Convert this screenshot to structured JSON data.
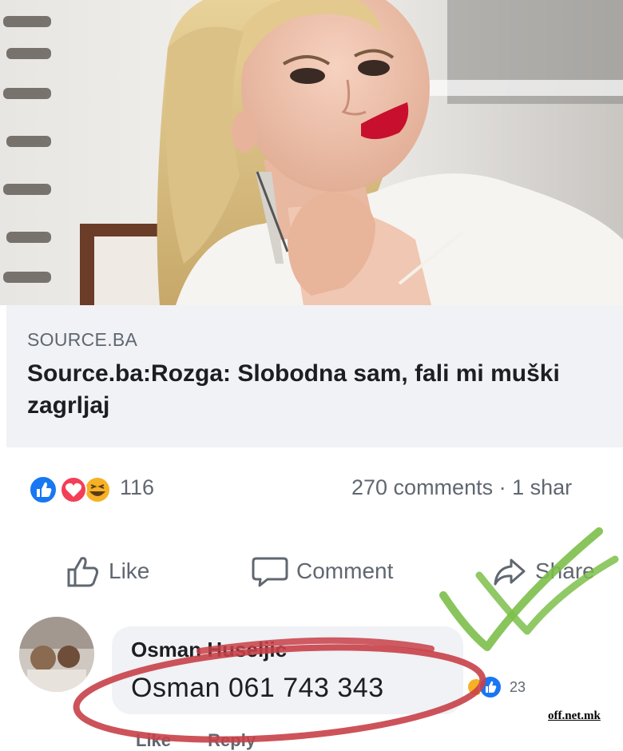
{
  "post": {
    "link": {
      "source": "SOURCE.BA",
      "title": "Source.ba:Rozga: Slobodna sam, fali mi muški zagrljaj"
    },
    "reactions": {
      "types": [
        "like-icon",
        "love-icon",
        "haha-icon"
      ],
      "count": "116"
    },
    "comments_shares": "270 comments · 1 shar",
    "actions": {
      "like": "Like",
      "comment": "Comment",
      "share": "Share"
    }
  },
  "comment": {
    "author": "Osman Huseljic",
    "text": "Osman 061 743 343",
    "reaction_count": "23",
    "actions": {
      "like": "Like",
      "reply": "Reply"
    }
  },
  "watermark": "off.net.mk",
  "colors": {
    "facebook_blue": "#1877f2",
    "love_red": "#f33e58",
    "haha_yellow": "#f7b125",
    "annotation_red": "#c84048",
    "annotation_green": "#7cbf4a",
    "card_gray": "#f0f2f5",
    "secondary_text": "#606770"
  }
}
